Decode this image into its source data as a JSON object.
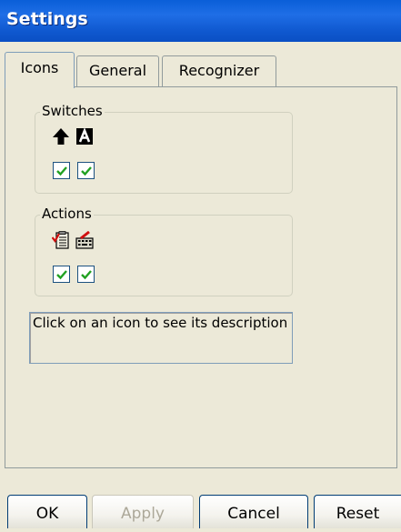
{
  "window": {
    "title": "Settings"
  },
  "tabs": [
    {
      "label": "Icons",
      "active": true
    },
    {
      "label": "General",
      "active": false
    },
    {
      "label": "Recognizer",
      "active": false
    }
  ],
  "switches": {
    "legend": "Switches",
    "items": [
      {
        "icon": "shift-arrow-up-icon",
        "checked": true
      },
      {
        "icon": "caps-lock-a-icon",
        "checked": true
      }
    ]
  },
  "actions": {
    "legend": "Actions",
    "items": [
      {
        "icon": "clipboard-check-icon",
        "checked": true
      },
      {
        "icon": "keyboard-edit-icon",
        "checked": true
      }
    ]
  },
  "description": {
    "text": "Click on an icon to see its description"
  },
  "buttons": {
    "ok": "OK",
    "apply": "Apply",
    "cancel": "Cancel",
    "reset": "Reset"
  },
  "colors": {
    "titlebar": "#0a5ed8",
    "face": "#ece9d8",
    "checkmark": "#21a121",
    "checkbox_border": "#1c5180"
  }
}
